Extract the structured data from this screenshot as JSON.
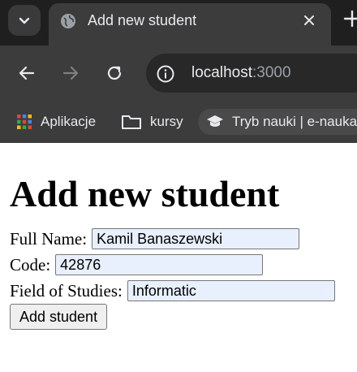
{
  "browser": {
    "tab": {
      "title": "Add new student"
    },
    "address_bar": {
      "host": "localhost",
      "port": ":3000"
    },
    "bookmarks": [
      {
        "label": "Aplikacje"
      },
      {
        "label": "kursy"
      },
      {
        "label": "Tryb nauki | e-nauka"
      }
    ]
  },
  "page": {
    "heading": "Add new student",
    "form": {
      "full_name": {
        "label": "Full Name:",
        "value": "Kamil Banaszewski"
      },
      "code": {
        "label": "Code:",
        "value": "42876"
      },
      "field_of_studies": {
        "label": "Field of Studies:",
        "value": "Informatic"
      },
      "submit_label": "Add student"
    }
  },
  "colors": {
    "tabstrip": "#1f1f1f",
    "toolbar": "#3c3c3c",
    "autofill_bg": "#e8f0fe"
  }
}
